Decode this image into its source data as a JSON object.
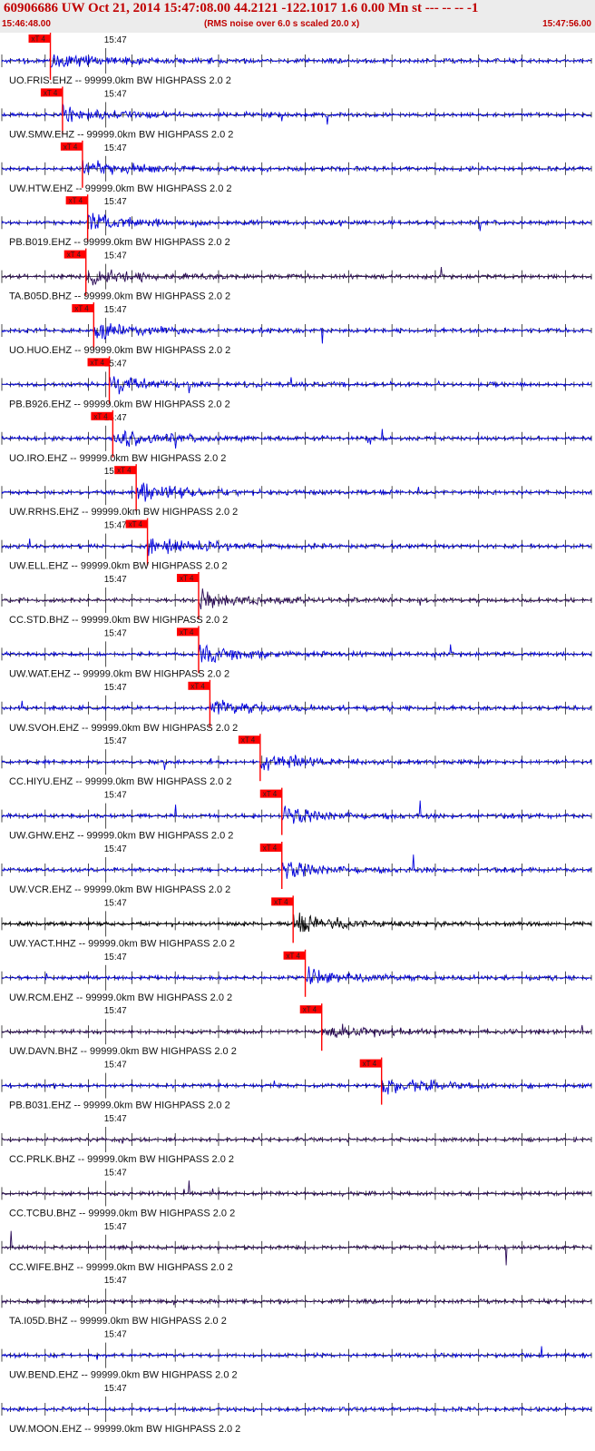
{
  "header": {
    "title": "60906686 UW Oct 21, 2014 15:47:08.00   44.2121 -122.1017  1.6 0.00 Mn st --- -- --  -1",
    "start_time": "15:46:48.00",
    "end_time": "15:47:56.00",
    "rms_note": "(RMS noise over 6.0 s scaled 20.0 x)"
  },
  "chart_data": {
    "type": "line",
    "x_range": [
      "15:46:48.00",
      "15:47:56.00"
    ],
    "minute_label": "15:47",
    "pick_label": "xT 4",
    "colors": {
      "trace_blue": "#0000dd",
      "trace_dark": "#2a0a55",
      "trace_black": "#000000",
      "pick": "#ff0000"
    },
    "traces": [
      {
        "label": "UO.FRIS.EHZ -- 99999.0km BW  HIGHPASS  2.0  2",
        "pick_s": 5.6,
        "color": "blue"
      },
      {
        "label": "UW.SMW.EHZ -- 99999.0km BW  HIGHPASS  2.0  2",
        "pick_s": 7.0,
        "color": "blue"
      },
      {
        "label": "UW.HTW.EHZ -- 99999.0km BW  HIGHPASS  2.0  2",
        "pick_s": 9.3,
        "color": "blue"
      },
      {
        "label": "PB.B019.EHZ -- 99999.0km BW  HIGHPASS  2.0  2",
        "pick_s": 9.9,
        "color": "blue"
      },
      {
        "label": "TA.B05D.BHZ -- 99999.0km BW  HIGHPASS  2.0  2",
        "pick_s": 9.7,
        "color": "dark"
      },
      {
        "label": "UO.HUO.EHZ -- 99999.0km BW  HIGHPASS  2.0  2",
        "pick_s": 10.6,
        "color": "blue"
      },
      {
        "label": "PB.B926.EHZ -- 99999.0km BW  HIGHPASS  2.0  2",
        "pick_s": 12.4,
        "color": "blue"
      },
      {
        "label": "UO.IRO.EHZ -- 99999.0km BW  HIGHPASS  2.0  2",
        "pick_s": 12.8,
        "color": "blue"
      },
      {
        "label": "UW.RRHS.EHZ -- 99999.0km BW  HIGHPASS  2.0  2",
        "pick_s": 15.5,
        "color": "blue"
      },
      {
        "label": "UW.ELL.EHZ -- 99999.0km BW  HIGHPASS  2.0  2",
        "pick_s": 16.8,
        "color": "blue"
      },
      {
        "label": "CC.STD.BHZ -- 99999.0km BW  HIGHPASS  2.0  2",
        "pick_s": 22.7,
        "color": "dark"
      },
      {
        "label": "UW.WAT.EHZ -- 99999.0km BW  HIGHPASS  2.0  2",
        "pick_s": 22.7,
        "color": "blue"
      },
      {
        "label": "UW.SVOH.EHZ -- 99999.0km BW  HIGHPASS  2.0  2",
        "pick_s": 24.0,
        "color": "blue"
      },
      {
        "label": "CC.HIYU.EHZ -- 99999.0km BW  HIGHPASS  2.0  2",
        "pick_s": 29.8,
        "color": "blue"
      },
      {
        "label": "UW.GHW.EHZ -- 99999.0km BW  HIGHPASS  2.0  2",
        "pick_s": 32.3,
        "color": "blue"
      },
      {
        "label": "UW.VCR.EHZ -- 99999.0km BW  HIGHPASS  2.0  2",
        "pick_s": 32.3,
        "color": "blue"
      },
      {
        "label": "UW.YACT.HHZ -- 99999.0km BW  HIGHPASS  2.0  2",
        "pick_s": 33.6,
        "color": "black"
      },
      {
        "label": "UW.RCM.EHZ -- 99999.0km BW  HIGHPASS  2.0  2",
        "pick_s": 35.0,
        "color": "blue"
      },
      {
        "label": "UW.DAVN.BHZ -- 99999.0km BW  HIGHPASS  2.0  2",
        "pick_s": 36.9,
        "color": "dark"
      },
      {
        "label": "PB.B031.EHZ -- 99999.0km BW  HIGHPASS  2.0  2",
        "pick_s": 43.8,
        "color": "blue"
      },
      {
        "label": "CC.PRLK.BHZ -- 99999.0km BW  HIGHPASS  2.0  2",
        "pick_s": null,
        "color": "dark"
      },
      {
        "label": "CC.TCBU.BHZ -- 99999.0km BW  HIGHPASS  2.0  2",
        "pick_s": null,
        "color": "dark"
      },
      {
        "label": "CC.WIFE.BHZ -- 99999.0km BW  HIGHPASS  2.0  2",
        "pick_s": null,
        "color": "dark"
      },
      {
        "label": "TA.I05D.BHZ -- 99999.0km BW  HIGHPASS  2.0  2",
        "pick_s": null,
        "color": "dark"
      },
      {
        "label": "UW.BEND.EHZ -- 99999.0km BW  HIGHPASS  2.0  2",
        "pick_s": null,
        "color": "blue"
      },
      {
        "label": "UW.MOON.EHZ -- 99999.0km BW  HIGHPASS  2.0  2",
        "pick_s": null,
        "color": "blue"
      }
    ]
  }
}
